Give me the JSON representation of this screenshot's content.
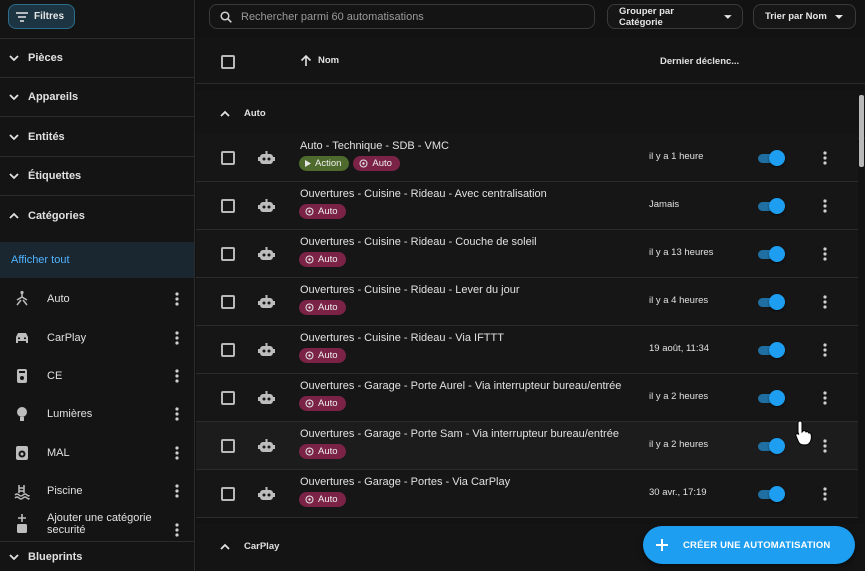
{
  "sidebar": {
    "filters_label": "Filtres",
    "sections": [
      {
        "label": "Pièces"
      },
      {
        "label": "Appareils"
      },
      {
        "label": "Entités"
      },
      {
        "label": "Étiquettes"
      },
      {
        "label": "Catégories"
      }
    ],
    "show_all": "Afficher tout",
    "categories": [
      {
        "label": "Auto",
        "icon": "auto-mode-icon"
      },
      {
        "label": "CarPlay",
        "icon": "car-icon"
      },
      {
        "label": "CE",
        "icon": "water-heater-icon"
      },
      {
        "label": "Lumières",
        "icon": "lightbulb-icon"
      },
      {
        "label": "MAL",
        "icon": "washing-machine-icon"
      },
      {
        "label": "Piscine",
        "icon": "pool-icon"
      }
    ],
    "add_category_line1": "Ajouter une catégorie",
    "add_category_line2": "securité",
    "blueprints_label": "Blueprints"
  },
  "toolbar": {
    "search_placeholder": "Rechercher parmi 60 automatisations",
    "group_by_label": "Grouper par Catégorie",
    "sort_by_label": "Trier par Nom"
  },
  "table": {
    "col_name": "Nom",
    "col_last_triggered": "Dernier déclenc...",
    "groups": [
      {
        "label": "Auto",
        "rows": [
          {
            "title": "Auto - Technique - SDB - VMC",
            "chips": [
              "Action",
              "Auto"
            ],
            "time": "il y a 1 heure",
            "enabled": true
          },
          {
            "title": "Ouvertures - Cuisine - Rideau - Avec centralisation",
            "chips": [
              "Auto"
            ],
            "time": "Jamais",
            "enabled": true
          },
          {
            "title": "Ouvertures - Cuisine - Rideau - Couche de soleil",
            "chips": [
              "Auto"
            ],
            "time": "il y a 13 heures",
            "enabled": true
          },
          {
            "title": "Ouvertures - Cuisine - Rideau - Lever du jour",
            "chips": [
              "Auto"
            ],
            "time": "il y a 4 heures",
            "enabled": true
          },
          {
            "title": "Ouvertures - Cuisine - Rideau - Via IFTTT",
            "chips": [
              "Auto"
            ],
            "time": "19 août, 11:34",
            "enabled": true
          },
          {
            "title": "Ouvertures - Garage - Porte Aurel - Via interrupteur bureau/entrée",
            "chips": [
              "Auto"
            ],
            "time": "il y a 2 heures",
            "enabled": true
          },
          {
            "title": "Ouvertures - Garage - Porte Sam - Via interrupteur bureau/entrée",
            "chips": [
              "Auto"
            ],
            "time": "il y a 2 heures",
            "enabled": true
          },
          {
            "title": "Ouvertures - Garage - Portes - Via CarPlay",
            "chips": [
              "Auto"
            ],
            "time": "30 avr., 17:19",
            "enabled": true
          }
        ]
      },
      {
        "label": "CarPlay",
        "rows": []
      }
    ]
  },
  "fab": {
    "label": "CRÉER UNE AUTOMATISATION"
  },
  "colors": {
    "accent": "#1e9ef0",
    "chip_action": "#4e6a2c",
    "chip_auto": "#7a2346"
  }
}
